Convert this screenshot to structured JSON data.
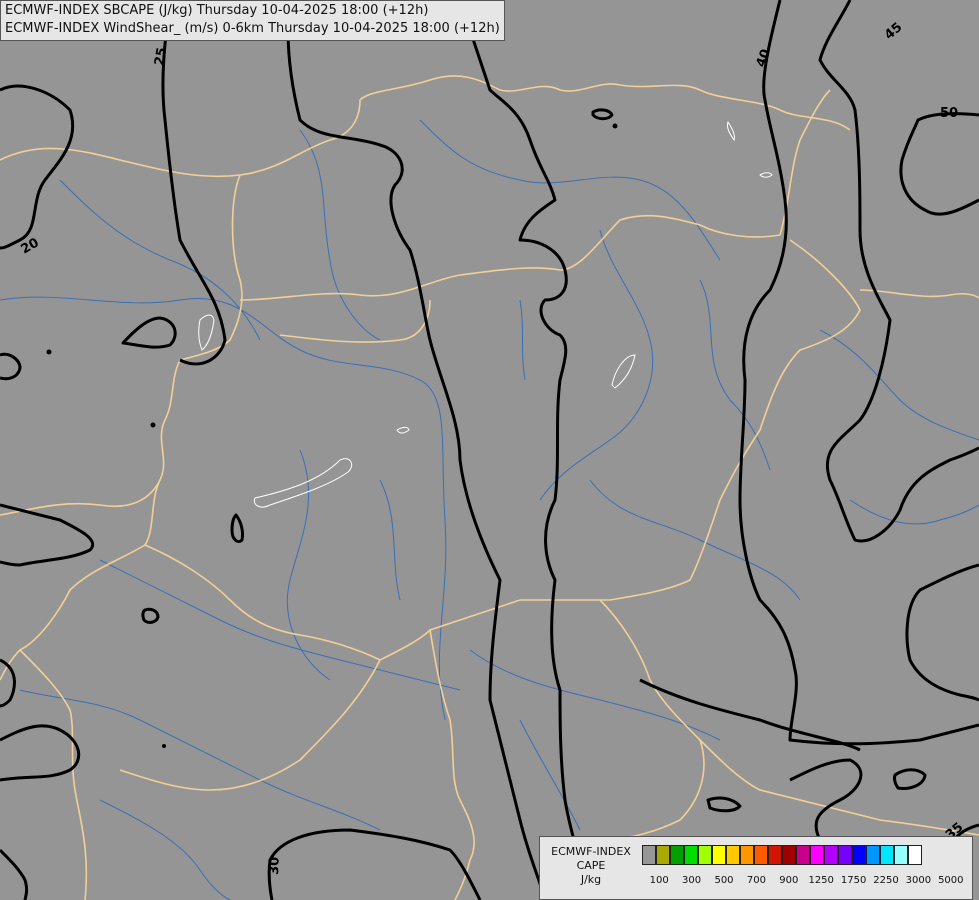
{
  "header": {
    "line1": "ECMWF-INDEX SBCAPE (J/kg) Thursday 10-04-2025 18:00 (+12h)",
    "line2": "ECMWF-INDEX WindShear_ (m/s) 0-6km Thursday 10-04-2025 18:00 (+12h)"
  },
  "map": {
    "background_color": "#959595",
    "border_color": "#f2cf96",
    "river_color": "#3b6fb6",
    "contour_color": "#000000",
    "contour_labels": [
      "25",
      "20",
      "40",
      "45",
      "50",
      "30",
      "35"
    ]
  },
  "legend": {
    "title_line1": "ECMWF-INDEX",
    "title_line2": "CAPE",
    "title_line3": "J/kg",
    "colors": [
      "#969696",
      "#a8a800",
      "#00a000",
      "#00dc00",
      "#a0ff00",
      "#ffff00",
      "#ffc800",
      "#ff9600",
      "#ff5a00",
      "#d21400",
      "#a00000",
      "#c8008c",
      "#ff00ff",
      "#b400ff",
      "#7800ff",
      "#0000ff",
      "#0096ff",
      "#00e6ff",
      "#96ffff",
      "#ffffff"
    ],
    "ticks": [
      "100",
      "300",
      "500",
      "700",
      "900",
      "1250",
      "1750",
      "2250",
      "3000",
      "5000"
    ]
  }
}
